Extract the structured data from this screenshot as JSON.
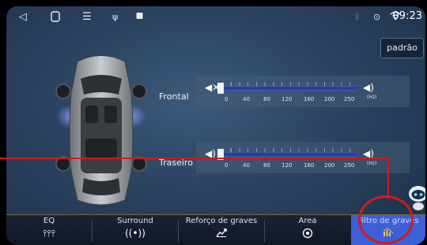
{
  "status_bar": {
    "time": "09:23",
    "icons": [
      "back-icon",
      "home-icon",
      "menu-icon",
      "usb-icon",
      "media-icon",
      "bluetooth-icon",
      "location-icon",
      "wifi-icon"
    ]
  },
  "preset": {
    "label": "padrão"
  },
  "zones": [
    {
      "label": "Frontal",
      "muted": true,
      "value_hz": 0,
      "ticks": [
        "0",
        "40",
        "80",
        "120",
        "160",
        "200",
        "250"
      ],
      "unit": "(Hz)"
    },
    {
      "label": "Traseiro",
      "muted": false,
      "value_hz": 0,
      "ticks": [
        "0",
        "40",
        "80",
        "120",
        "160",
        "200",
        "250"
      ],
      "unit": "(Hz)"
    }
  ],
  "tabs": [
    {
      "label": "EQ",
      "icon": "equalizer-icon",
      "active": false
    },
    {
      "label": "Surround",
      "icon": "surround-icon",
      "active": false
    },
    {
      "label": "Reforço de graves",
      "icon": "bass-boost-icon",
      "active": false
    },
    {
      "label": "Area",
      "icon": "area-target-icon",
      "active": false
    },
    {
      "label": "Filtro de graves",
      "icon": "bass-filter-icon",
      "active": true
    }
  ],
  "colors": {
    "accent": "#3d5fd8",
    "annotation": "#d21a1a",
    "track": "#2d3d9c"
  }
}
